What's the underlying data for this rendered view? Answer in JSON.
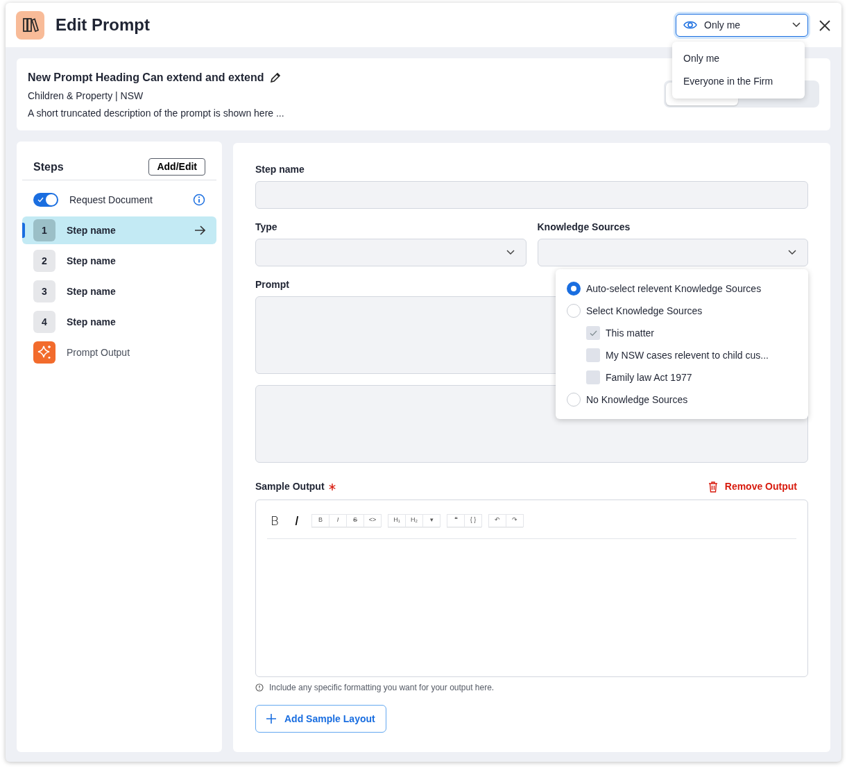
{
  "header": {
    "title": "Edit Prompt",
    "visibility": {
      "value": "Only me",
      "options": [
        {
          "label": "Only me"
        },
        {
          "label": "Everyone in the Firm"
        }
      ]
    }
  },
  "prompt": {
    "heading": "New Prompt Heading Can extend and extend",
    "meta": "Children & Property | NSW",
    "description": "A short truncated description of the prompt is shown here ..."
  },
  "steps": {
    "title": "Steps",
    "edit_button": "Add/Edit",
    "request": {
      "label": "Request Document",
      "on": true
    },
    "items": [
      {
        "number": "1",
        "label": "Step name",
        "selected": true
      },
      {
        "number": "2",
        "label": "Step name",
        "selected": false
      },
      {
        "number": "3",
        "label": "Step name",
        "selected": false
      },
      {
        "number": "4",
        "label": "Step name",
        "selected": false
      }
    ],
    "output": {
      "label": "Prompt Output"
    }
  },
  "form": {
    "step_name": {
      "label": "Step name"
    },
    "type": {
      "label": "Type"
    },
    "knowledge": {
      "label": "Knowledge Sources",
      "options": [
        {
          "label": "Auto-select relevent Knowledge Sources",
          "selected": true
        },
        {
          "label": "Select Knowledge Sources",
          "selected": false,
          "children": [
            {
              "label": "This matter",
              "checked": true
            },
            {
              "label": "My NSW cases relevent to child cus...",
              "checked": false
            },
            {
              "label": "Family law Act 1977",
              "checked": false
            }
          ]
        },
        {
          "label": "No Knowledge Sources",
          "selected": false
        }
      ]
    },
    "prompt": {
      "label": "Prompt"
    }
  },
  "sample": {
    "label": "Sample Output",
    "required": true,
    "remove": "Remove Output",
    "toolbar_main": [
      {
        "label": "B",
        "kind": "plain"
      },
      {
        "label": "I",
        "kind": "italic"
      }
    ],
    "toolbar_groups": [
      [
        {
          "label": "B",
          "kind": "plain"
        },
        {
          "label": "I",
          "kind": "italic"
        },
        {
          "label": "S",
          "kind": "strike"
        },
        {
          "label": "<>",
          "kind": "plain"
        }
      ],
      [
        {
          "label": "H₁",
          "kind": "plain"
        },
        {
          "label": "H₂",
          "kind": "plain"
        },
        {
          "label": "▾",
          "kind": "plain"
        }
      ],
      [
        {
          "label": "❝",
          "kind": "plain"
        },
        {
          "label": "{ }",
          "kind": "plain"
        }
      ],
      [
        {
          "label": "↶",
          "kind": "plain"
        },
        {
          "label": "↷",
          "kind": "plain"
        }
      ]
    ],
    "hint": "Include any specific formatting you want for your output here.",
    "add_button": "Add Sample Layout"
  }
}
